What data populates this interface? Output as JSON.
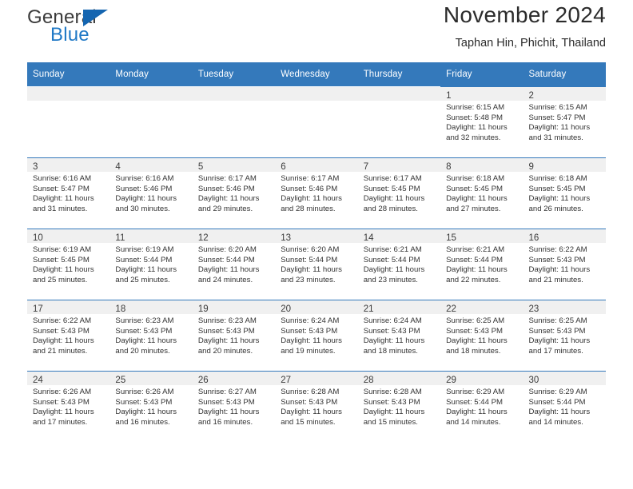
{
  "brand": {
    "line1": "General",
    "line2": "Blue",
    "flag_color": "#1565b0"
  },
  "header": {
    "title": "November 2024",
    "subtitle": "Taphan Hin, Phichit, Thailand"
  },
  "theme": {
    "header_blue": "#3479bb",
    "band_gray": "#f0f0f0",
    "text": "#333333"
  },
  "labels": {
    "sunrise_prefix": "Sunrise:",
    "sunset_prefix": "Sunset:",
    "daylight_prefix": "Daylight:"
  },
  "weekdays": [
    "Sunday",
    "Monday",
    "Tuesday",
    "Wednesday",
    "Thursday",
    "Friday",
    "Saturday"
  ],
  "weeks": [
    [
      {
        "day": "",
        "sunrise": "",
        "sunset": "",
        "daylight_l1": "",
        "daylight_l2": ""
      },
      {
        "day": "",
        "sunrise": "",
        "sunset": "",
        "daylight_l1": "",
        "daylight_l2": ""
      },
      {
        "day": "",
        "sunrise": "",
        "sunset": "",
        "daylight_l1": "",
        "daylight_l2": ""
      },
      {
        "day": "",
        "sunrise": "",
        "sunset": "",
        "daylight_l1": "",
        "daylight_l2": ""
      },
      {
        "day": "",
        "sunrise": "",
        "sunset": "",
        "daylight_l1": "",
        "daylight_l2": ""
      },
      {
        "day": "1",
        "sunrise": "Sunrise: 6:15 AM",
        "sunset": "Sunset: 5:48 PM",
        "daylight_l1": "Daylight: 11 hours",
        "daylight_l2": "and 32 minutes."
      },
      {
        "day": "2",
        "sunrise": "Sunrise: 6:15 AM",
        "sunset": "Sunset: 5:47 PM",
        "daylight_l1": "Daylight: 11 hours",
        "daylight_l2": "and 31 minutes."
      }
    ],
    [
      {
        "day": "3",
        "sunrise": "Sunrise: 6:16 AM",
        "sunset": "Sunset: 5:47 PM",
        "daylight_l1": "Daylight: 11 hours",
        "daylight_l2": "and 31 minutes."
      },
      {
        "day": "4",
        "sunrise": "Sunrise: 6:16 AM",
        "sunset": "Sunset: 5:46 PM",
        "daylight_l1": "Daylight: 11 hours",
        "daylight_l2": "and 30 minutes."
      },
      {
        "day": "5",
        "sunrise": "Sunrise: 6:17 AM",
        "sunset": "Sunset: 5:46 PM",
        "daylight_l1": "Daylight: 11 hours",
        "daylight_l2": "and 29 minutes."
      },
      {
        "day": "6",
        "sunrise": "Sunrise: 6:17 AM",
        "sunset": "Sunset: 5:46 PM",
        "daylight_l1": "Daylight: 11 hours",
        "daylight_l2": "and 28 minutes."
      },
      {
        "day": "7",
        "sunrise": "Sunrise: 6:17 AM",
        "sunset": "Sunset: 5:45 PM",
        "daylight_l1": "Daylight: 11 hours",
        "daylight_l2": "and 28 minutes."
      },
      {
        "day": "8",
        "sunrise": "Sunrise: 6:18 AM",
        "sunset": "Sunset: 5:45 PM",
        "daylight_l1": "Daylight: 11 hours",
        "daylight_l2": "and 27 minutes."
      },
      {
        "day": "9",
        "sunrise": "Sunrise: 6:18 AM",
        "sunset": "Sunset: 5:45 PM",
        "daylight_l1": "Daylight: 11 hours",
        "daylight_l2": "and 26 minutes."
      }
    ],
    [
      {
        "day": "10",
        "sunrise": "Sunrise: 6:19 AM",
        "sunset": "Sunset: 5:45 PM",
        "daylight_l1": "Daylight: 11 hours",
        "daylight_l2": "and 25 minutes."
      },
      {
        "day": "11",
        "sunrise": "Sunrise: 6:19 AM",
        "sunset": "Sunset: 5:44 PM",
        "daylight_l1": "Daylight: 11 hours",
        "daylight_l2": "and 25 minutes."
      },
      {
        "day": "12",
        "sunrise": "Sunrise: 6:20 AM",
        "sunset": "Sunset: 5:44 PM",
        "daylight_l1": "Daylight: 11 hours",
        "daylight_l2": "and 24 minutes."
      },
      {
        "day": "13",
        "sunrise": "Sunrise: 6:20 AM",
        "sunset": "Sunset: 5:44 PM",
        "daylight_l1": "Daylight: 11 hours",
        "daylight_l2": "and 23 minutes."
      },
      {
        "day": "14",
        "sunrise": "Sunrise: 6:21 AM",
        "sunset": "Sunset: 5:44 PM",
        "daylight_l1": "Daylight: 11 hours",
        "daylight_l2": "and 23 minutes."
      },
      {
        "day": "15",
        "sunrise": "Sunrise: 6:21 AM",
        "sunset": "Sunset: 5:44 PM",
        "daylight_l1": "Daylight: 11 hours",
        "daylight_l2": "and 22 minutes."
      },
      {
        "day": "16",
        "sunrise": "Sunrise: 6:22 AM",
        "sunset": "Sunset: 5:43 PM",
        "daylight_l1": "Daylight: 11 hours",
        "daylight_l2": "and 21 minutes."
      }
    ],
    [
      {
        "day": "17",
        "sunrise": "Sunrise: 6:22 AM",
        "sunset": "Sunset: 5:43 PM",
        "daylight_l1": "Daylight: 11 hours",
        "daylight_l2": "and 21 minutes."
      },
      {
        "day": "18",
        "sunrise": "Sunrise: 6:23 AM",
        "sunset": "Sunset: 5:43 PM",
        "daylight_l1": "Daylight: 11 hours",
        "daylight_l2": "and 20 minutes."
      },
      {
        "day": "19",
        "sunrise": "Sunrise: 6:23 AM",
        "sunset": "Sunset: 5:43 PM",
        "daylight_l1": "Daylight: 11 hours",
        "daylight_l2": "and 20 minutes."
      },
      {
        "day": "20",
        "sunrise": "Sunrise: 6:24 AM",
        "sunset": "Sunset: 5:43 PM",
        "daylight_l1": "Daylight: 11 hours",
        "daylight_l2": "and 19 minutes."
      },
      {
        "day": "21",
        "sunrise": "Sunrise: 6:24 AM",
        "sunset": "Sunset: 5:43 PM",
        "daylight_l1": "Daylight: 11 hours",
        "daylight_l2": "and 18 minutes."
      },
      {
        "day": "22",
        "sunrise": "Sunrise: 6:25 AM",
        "sunset": "Sunset: 5:43 PM",
        "daylight_l1": "Daylight: 11 hours",
        "daylight_l2": "and 18 minutes."
      },
      {
        "day": "23",
        "sunrise": "Sunrise: 6:25 AM",
        "sunset": "Sunset: 5:43 PM",
        "daylight_l1": "Daylight: 11 hours",
        "daylight_l2": "and 17 minutes."
      }
    ],
    [
      {
        "day": "24",
        "sunrise": "Sunrise: 6:26 AM",
        "sunset": "Sunset: 5:43 PM",
        "daylight_l1": "Daylight: 11 hours",
        "daylight_l2": "and 17 minutes."
      },
      {
        "day": "25",
        "sunrise": "Sunrise: 6:26 AM",
        "sunset": "Sunset: 5:43 PM",
        "daylight_l1": "Daylight: 11 hours",
        "daylight_l2": "and 16 minutes."
      },
      {
        "day": "26",
        "sunrise": "Sunrise: 6:27 AM",
        "sunset": "Sunset: 5:43 PM",
        "daylight_l1": "Daylight: 11 hours",
        "daylight_l2": "and 16 minutes."
      },
      {
        "day": "27",
        "sunrise": "Sunrise: 6:28 AM",
        "sunset": "Sunset: 5:43 PM",
        "daylight_l1": "Daylight: 11 hours",
        "daylight_l2": "and 15 minutes."
      },
      {
        "day": "28",
        "sunrise": "Sunrise: 6:28 AM",
        "sunset": "Sunset: 5:43 PM",
        "daylight_l1": "Daylight: 11 hours",
        "daylight_l2": "and 15 minutes."
      },
      {
        "day": "29",
        "sunrise": "Sunrise: 6:29 AM",
        "sunset": "Sunset: 5:44 PM",
        "daylight_l1": "Daylight: 11 hours",
        "daylight_l2": "and 14 minutes."
      },
      {
        "day": "30",
        "sunrise": "Sunrise: 6:29 AM",
        "sunset": "Sunset: 5:44 PM",
        "daylight_l1": "Daylight: 11 hours",
        "daylight_l2": "and 14 minutes."
      }
    ]
  ]
}
